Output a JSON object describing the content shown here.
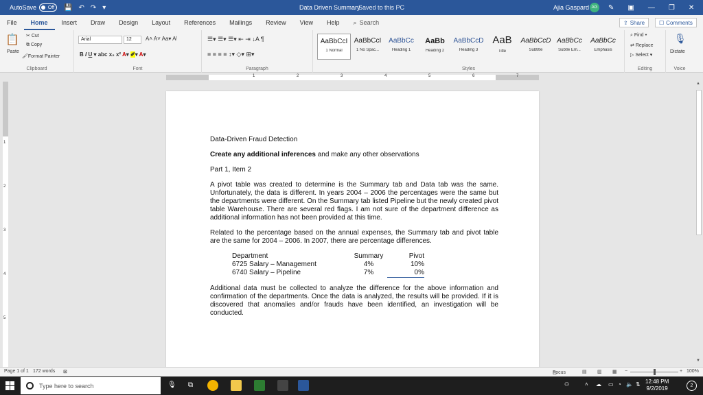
{
  "titlebar": {
    "autosave_label": "AutoSave",
    "autosave_state": "Off",
    "doc_title": "Data Driven Summary",
    "save_status": "Saved to this PC",
    "user_name": "Ajia Gaspard",
    "user_initials": "AG",
    "accent_color": "#2b579a"
  },
  "tabs": [
    "File",
    "Home",
    "Insert",
    "Draw",
    "Design",
    "Layout",
    "References",
    "Mailings",
    "Review",
    "View",
    "Help"
  ],
  "active_tab": "Home",
  "search": {
    "placeholder": "Search"
  },
  "share_label": "Share",
  "comments_label": "Comments",
  "ribbon": {
    "clipboard": {
      "paste": "Paste",
      "cut": "Cut",
      "copy": "Copy",
      "format_painter": "Format Painter",
      "label": "Clipboard"
    },
    "font": {
      "name": "Arial",
      "size": "12",
      "label": "Font"
    },
    "paragraph_label": "Paragraph",
    "styles_label": "Styles",
    "styles": [
      {
        "sample": "AaBbCcI",
        "name": "1 Normal"
      },
      {
        "sample": "AaBbCcI",
        "name": "1 No Spac..."
      },
      {
        "sample": "AaBbCc",
        "name": "Heading 1"
      },
      {
        "sample": "AaBb",
        "name": "Heading 2"
      },
      {
        "sample": "AaBbCcD",
        "name": "Heading 3"
      },
      {
        "sample": "AaB",
        "name": "Title"
      },
      {
        "sample": "AaBbCcD",
        "name": "Subtitle"
      },
      {
        "sample": "AaBbCc",
        "name": "Subtle Em..."
      },
      {
        "sample": "AaBbCc",
        "name": "Emphasis"
      }
    ],
    "editing": {
      "find": "Find",
      "replace": "Replace",
      "select": "Select",
      "label": "Editing"
    },
    "voice": {
      "dictate": "Dictate",
      "label": "Voice"
    }
  },
  "ruler_numbers": [
    "1",
    "2",
    "3",
    "4",
    "5",
    "6",
    "7"
  ],
  "vruler_numbers": [
    "1",
    "2",
    "3",
    "4",
    "5"
  ],
  "document": {
    "heading": "Data-Driven Fraud Detection",
    "instruction_bold": "Create any additional inferences",
    "instruction_rest": " and make any other observations",
    "part": "Part 1, Item 2",
    "para1": "A pivot table was created to determine is the Summary tab and Data tab was the same. Unfortunately, the data is different. In years 2004 – 2006 the percentages were the same but the departments were different. On the Summary tab listed Pipeline but the newly created pivot table Warehouse. There are several red flags. I am not sure of the department difference as additional information has not been provided at this time.",
    "para2": "Related to the percentage based on the annual expenses, the Summary tab and pivot table are the same for 2004 – 2006. In 2007, there are percentage differences.",
    "table": {
      "headers": [
        "Department",
        "Summary",
        "Pivot"
      ],
      "rows": [
        [
          "6725 Salary – Management",
          "4%",
          "10%"
        ],
        [
          "6740 Salary – Pipeline",
          "7%",
          "0%"
        ]
      ]
    },
    "para3": "Additional data must be collected to analyze the difference for the above information and confirmation of the departments. Once the data is analyzed, the results will be provided. If it is discovered that anomalies and/or frauds have been identified, an investigation will be conducted."
  },
  "statusbar": {
    "page": "Page 1 of 1",
    "words": "172 words",
    "focus": "Focus",
    "zoom": "100%"
  },
  "taskbar": {
    "search_placeholder": "Type here to search",
    "time": "12:48 PM",
    "date": "9/2/2019",
    "notifications": "2"
  }
}
